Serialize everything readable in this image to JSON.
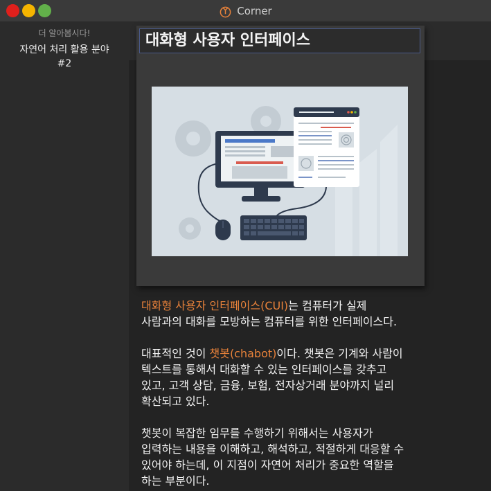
{
  "window": {
    "app_title": "Corner",
    "colors": {
      "close": "#e0201c",
      "minimize": "#f5b400",
      "maximize": "#62b04a"
    }
  },
  "sidebar": {
    "subtitle": "더 알아봅시다!",
    "title_line1": "자연어 처리 활용 분야",
    "title_line2": "#2"
  },
  "main": {
    "title": "대화형 사용자 인터페이스",
    "illustration_icon": "computer-interface-illustration",
    "paragraphs": [
      {
        "lines": [
          [
            {
              "text": "대화형 사용자 인터페이스(CUI)",
              "hl": true
            },
            {
              "text": "는 컴퓨터가 실제",
              "hl": false
            }
          ],
          [
            {
              "text": "사람과의 대화를 모방하는 컴퓨터를 위한 인터페이스다.",
              "hl": false
            }
          ]
        ]
      },
      {
        "lines": [
          [
            {
              "text": "대표적인 것이 ",
              "hl": false
            },
            {
              "text": "챗봇(chabot)",
              "hl": true
            },
            {
              "text": "이다. 챗봇은 기계와 사람이",
              "hl": false
            }
          ],
          [
            {
              "text": "텍스트를 통해서 대화할 수 있는 인터페이스를 갖추고",
              "hl": false
            }
          ],
          [
            {
              "text": "있고, 고객 상담, 금융, 보험, 전자상거래 분야까지 널리",
              "hl": false
            }
          ],
          [
            {
              "text": "확산되고 있다.",
              "hl": false
            }
          ]
        ]
      },
      {
        "lines": [
          [
            {
              "text": "챗봇이 복잡한 임무를 수행하기 위해서는 사용자가",
              "hl": false
            }
          ],
          [
            {
              "text": "입력하는 내용을 이해하고, 해석하고, 적절하게 대응할 수",
              "hl": false
            }
          ],
          [
            {
              "text": "있어야 하는데, 이 지점이 자연어 처리가 중요한 역할을",
              "hl": false
            }
          ],
          [
            {
              "text": "하는 부분이다.",
              "hl": false
            }
          ]
        ]
      }
    ],
    "highlight_color": "#e8823a"
  }
}
